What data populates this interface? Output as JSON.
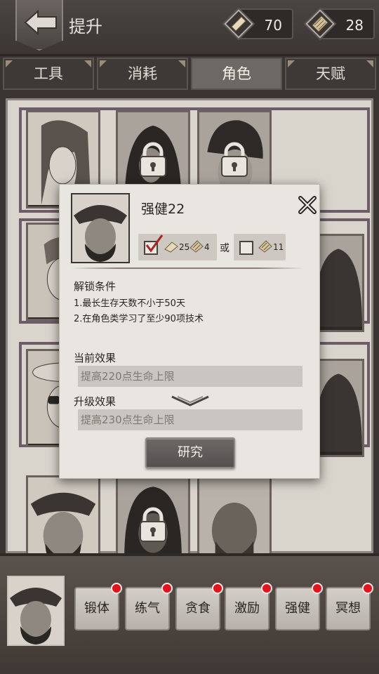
{
  "header": {
    "title": "提升",
    "resource1": {
      "value": "70",
      "icon": "paper-scrap-icon"
    },
    "resource2": {
      "value": "28",
      "icon": "scroll-bundle-icon"
    }
  },
  "tabs": [
    {
      "label": "工具",
      "active": false
    },
    {
      "label": "消耗",
      "active": false
    },
    {
      "label": "角色",
      "active": true
    },
    {
      "label": "天赋",
      "active": false
    }
  ],
  "popup": {
    "name": "强健22",
    "cost_option1": {
      "checked": true,
      "paper": "25",
      "scroll": "4"
    },
    "or_label": "或",
    "cost_option2": {
      "checked": false,
      "scroll": "11"
    },
    "unlock_title": "解锁条件",
    "conditions": [
      "1.最长生存天数不小于50天",
      "2.在角色类学习了至少90项技术"
    ],
    "current_effect_title": "当前效果",
    "current_effect": "提高220点生命上限",
    "upgrade_effect_title": "升级效果",
    "upgrade_effect": "提高230点生命上限",
    "research_label": "研究"
  },
  "skills": [
    {
      "label": "锻体",
      "alert": true
    },
    {
      "label": "练气",
      "alert": true
    },
    {
      "label": "贪食",
      "alert": true
    },
    {
      "label": "激励",
      "alert": true
    },
    {
      "label": "强健",
      "alert": true
    },
    {
      "label": "冥想",
      "alert": true
    }
  ],
  "colors": {
    "alert_dot": "#e3131e",
    "active_tab": "#6e6864",
    "panel_bg": "#e9e6e1"
  }
}
